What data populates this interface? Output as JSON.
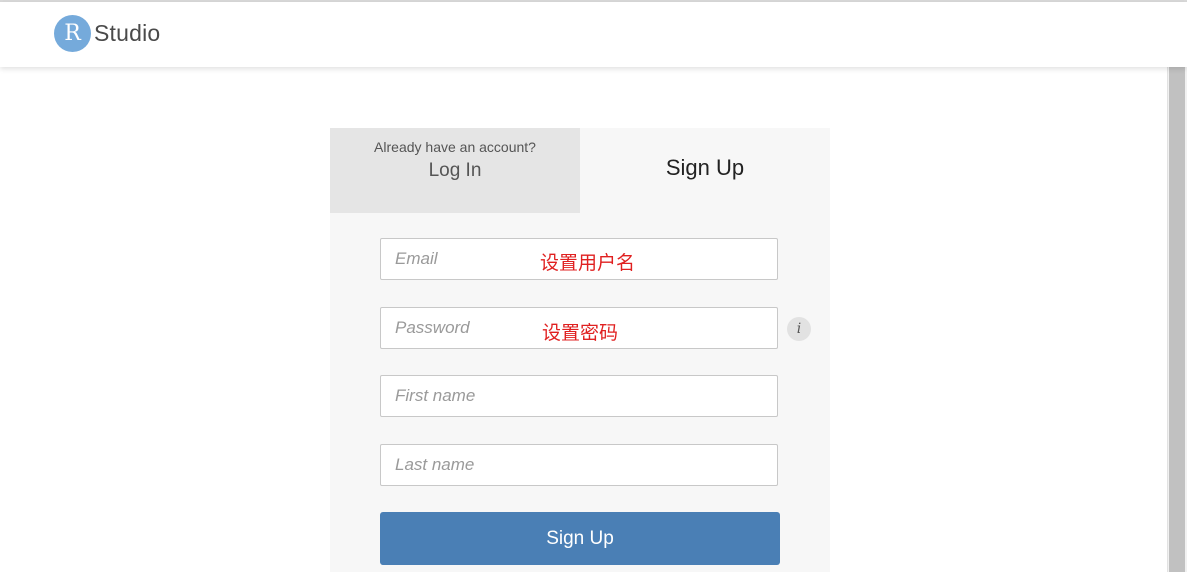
{
  "header": {
    "logo_letter": "R",
    "logo_text": "Studio"
  },
  "tabs": {
    "login_hint": "Already have an account?",
    "login_label": "Log In",
    "signup_label": "Sign Up"
  },
  "form": {
    "email_placeholder": "Email",
    "password_placeholder": "Password",
    "first_name_placeholder": "First name",
    "last_name_placeholder": "Last name",
    "info_icon_glyph": "i",
    "submit_label": "Sign Up"
  },
  "annotations": {
    "email_note": "设置用户名",
    "password_note": "设置密码"
  },
  "colors": {
    "brand": "#75aadb",
    "primary_button": "#4a7fb5",
    "annotation": "#e02020"
  },
  "icons": {
    "logo": "rstudio-logo-icon",
    "info": "info-icon"
  }
}
